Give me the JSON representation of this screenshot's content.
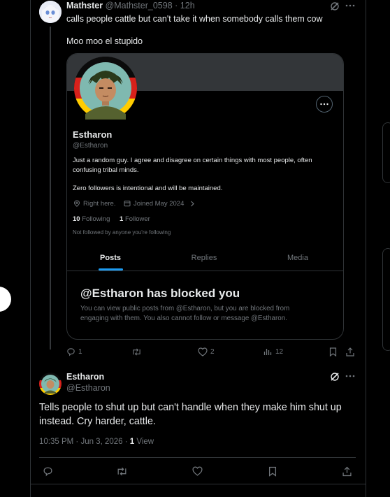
{
  "colors": {
    "accent": "#1d9bf0",
    "muted": "#71767b",
    "border": "#2f3336",
    "text": "#e7e9ea"
  },
  "quoted_post": {
    "display_name": "Mathster",
    "handle": "@Mathster_0598",
    "separator": "·",
    "time": "12h",
    "text_line1": "calls people cattle but can't take it when somebody calls them cow",
    "text_line2": "Moo moo el stupido",
    "actions": {
      "replies": "1",
      "reposts": "",
      "likes": "2",
      "views": "12"
    }
  },
  "profile_card": {
    "name": "Estharon",
    "handle": "@Estharon",
    "bio_line1": "Just a random guy. I agree and disagree on certain things with most people, often",
    "bio_line2": "confusing tribal minds.",
    "bio_line3": "Zero followers is intentional and will be maintained.",
    "location": "Right here.",
    "joined": "Joined May 2024",
    "following_count": "10",
    "following_label": "Following",
    "followers_count": "1",
    "followers_label": "Follower",
    "not_followed": "Not followed by anyone you're following",
    "tabs": [
      "Posts",
      "Replies",
      "Media"
    ],
    "blocked_title": "@Estharon has blocked you",
    "blocked_text_line1": "You can view public posts from @Estharon, but you are blocked from",
    "blocked_text_line2": "engaging with them. You also cannot follow or message @Estharon."
  },
  "reply_post": {
    "display_name": "Estharon",
    "handle": "@Estharon",
    "text_line1": "Tells people to shut up but can't handle when they make him shut up",
    "text_line2": "instead. Cry harder, cattle.",
    "timestamp": "10:35 PM · Jun 3, 2026 · ",
    "views_count": "1",
    "views_label": "View"
  },
  "icons": [
    "grok-icon",
    "more-icon",
    "reply-icon",
    "repost-icon",
    "like-icon",
    "views-icon",
    "bookmark-icon",
    "share-icon",
    "location-icon",
    "calendar-icon",
    "chevron-right-icon"
  ]
}
